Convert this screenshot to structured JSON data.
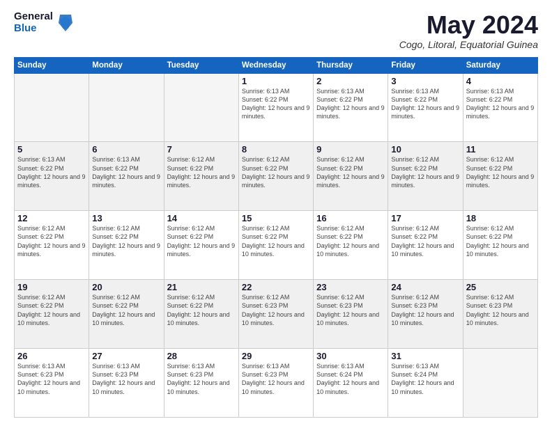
{
  "logo": {
    "general": "General",
    "blue": "Blue"
  },
  "header": {
    "month": "May 2024",
    "location": "Cogo, Litoral, Equatorial Guinea"
  },
  "weekdays": [
    "Sunday",
    "Monday",
    "Tuesday",
    "Wednesday",
    "Thursday",
    "Friday",
    "Saturday"
  ],
  "weeks": [
    {
      "shaded": false,
      "days": [
        {
          "num": "",
          "info": ""
        },
        {
          "num": "",
          "info": ""
        },
        {
          "num": "",
          "info": ""
        },
        {
          "num": "1",
          "info": "Sunrise: 6:13 AM\nSunset: 6:22 PM\nDaylight: 12 hours\nand 9 minutes."
        },
        {
          "num": "2",
          "info": "Sunrise: 6:13 AM\nSunset: 6:22 PM\nDaylight: 12 hours\nand 9 minutes."
        },
        {
          "num": "3",
          "info": "Sunrise: 6:13 AM\nSunset: 6:22 PM\nDaylight: 12 hours\nand 9 minutes."
        },
        {
          "num": "4",
          "info": "Sunrise: 6:13 AM\nSunset: 6:22 PM\nDaylight: 12 hours\nand 9 minutes."
        }
      ]
    },
    {
      "shaded": true,
      "days": [
        {
          "num": "5",
          "info": "Sunrise: 6:13 AM\nSunset: 6:22 PM\nDaylight: 12 hours\nand 9 minutes."
        },
        {
          "num": "6",
          "info": "Sunrise: 6:13 AM\nSunset: 6:22 PM\nDaylight: 12 hours\nand 9 minutes."
        },
        {
          "num": "7",
          "info": "Sunrise: 6:12 AM\nSunset: 6:22 PM\nDaylight: 12 hours\nand 9 minutes."
        },
        {
          "num": "8",
          "info": "Sunrise: 6:12 AM\nSunset: 6:22 PM\nDaylight: 12 hours\nand 9 minutes."
        },
        {
          "num": "9",
          "info": "Sunrise: 6:12 AM\nSunset: 6:22 PM\nDaylight: 12 hours\nand 9 minutes."
        },
        {
          "num": "10",
          "info": "Sunrise: 6:12 AM\nSunset: 6:22 PM\nDaylight: 12 hours\nand 9 minutes."
        },
        {
          "num": "11",
          "info": "Sunrise: 6:12 AM\nSunset: 6:22 PM\nDaylight: 12 hours\nand 9 minutes."
        }
      ]
    },
    {
      "shaded": false,
      "days": [
        {
          "num": "12",
          "info": "Sunrise: 6:12 AM\nSunset: 6:22 PM\nDaylight: 12 hours\nand 9 minutes."
        },
        {
          "num": "13",
          "info": "Sunrise: 6:12 AM\nSunset: 6:22 PM\nDaylight: 12 hours\nand 9 minutes."
        },
        {
          "num": "14",
          "info": "Sunrise: 6:12 AM\nSunset: 6:22 PM\nDaylight: 12 hours\nand 9 minutes."
        },
        {
          "num": "15",
          "info": "Sunrise: 6:12 AM\nSunset: 6:22 PM\nDaylight: 12 hours\nand 10 minutes."
        },
        {
          "num": "16",
          "info": "Sunrise: 6:12 AM\nSunset: 6:22 PM\nDaylight: 12 hours\nand 10 minutes."
        },
        {
          "num": "17",
          "info": "Sunrise: 6:12 AM\nSunset: 6:22 PM\nDaylight: 12 hours\nand 10 minutes."
        },
        {
          "num": "18",
          "info": "Sunrise: 6:12 AM\nSunset: 6:22 PM\nDaylight: 12 hours\nand 10 minutes."
        }
      ]
    },
    {
      "shaded": true,
      "days": [
        {
          "num": "19",
          "info": "Sunrise: 6:12 AM\nSunset: 6:22 PM\nDaylight: 12 hours\nand 10 minutes."
        },
        {
          "num": "20",
          "info": "Sunrise: 6:12 AM\nSunset: 6:22 PM\nDaylight: 12 hours\nand 10 minutes."
        },
        {
          "num": "21",
          "info": "Sunrise: 6:12 AM\nSunset: 6:22 PM\nDaylight: 12 hours\nand 10 minutes."
        },
        {
          "num": "22",
          "info": "Sunrise: 6:12 AM\nSunset: 6:23 PM\nDaylight: 12 hours\nand 10 minutes."
        },
        {
          "num": "23",
          "info": "Sunrise: 6:12 AM\nSunset: 6:23 PM\nDaylight: 12 hours\nand 10 minutes."
        },
        {
          "num": "24",
          "info": "Sunrise: 6:12 AM\nSunset: 6:23 PM\nDaylight: 12 hours\nand 10 minutes."
        },
        {
          "num": "25",
          "info": "Sunrise: 6:12 AM\nSunset: 6:23 PM\nDaylight: 12 hours\nand 10 minutes."
        }
      ]
    },
    {
      "shaded": false,
      "days": [
        {
          "num": "26",
          "info": "Sunrise: 6:13 AM\nSunset: 6:23 PM\nDaylight: 12 hours\nand 10 minutes."
        },
        {
          "num": "27",
          "info": "Sunrise: 6:13 AM\nSunset: 6:23 PM\nDaylight: 12 hours\nand 10 minutes."
        },
        {
          "num": "28",
          "info": "Sunrise: 6:13 AM\nSunset: 6:23 PM\nDaylight: 12 hours\nand 10 minutes."
        },
        {
          "num": "29",
          "info": "Sunrise: 6:13 AM\nSunset: 6:23 PM\nDaylight: 12 hours\nand 10 minutes."
        },
        {
          "num": "30",
          "info": "Sunrise: 6:13 AM\nSunset: 6:24 PM\nDaylight: 12 hours\nand 10 minutes."
        },
        {
          "num": "31",
          "info": "Sunrise: 6:13 AM\nSunset: 6:24 PM\nDaylight: 12 hours\nand 10 minutes."
        },
        {
          "num": "",
          "info": ""
        }
      ]
    }
  ]
}
